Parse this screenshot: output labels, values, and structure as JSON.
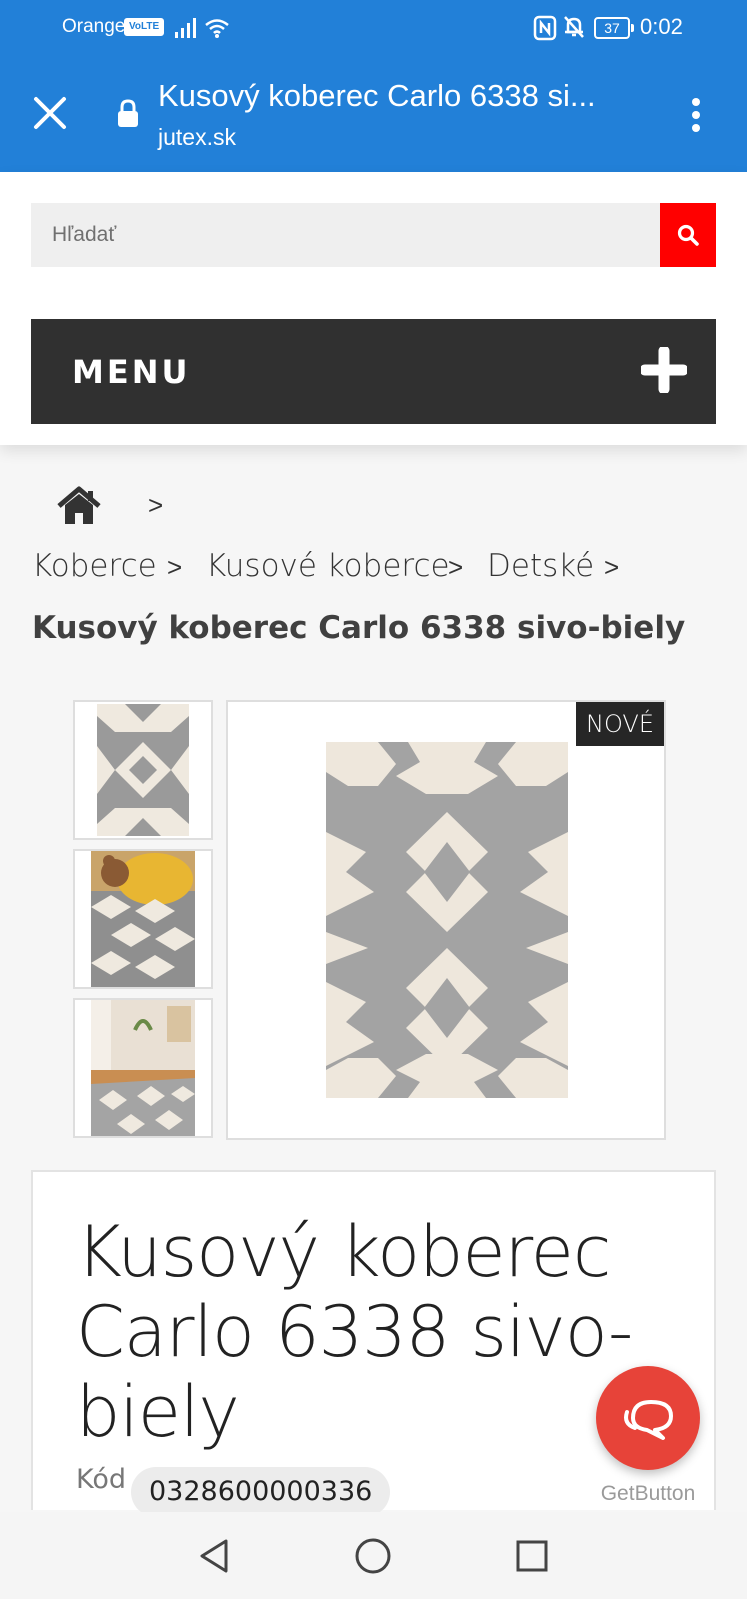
{
  "status_bar": {
    "carrier": "Orange",
    "volte": "VoLTE",
    "battery": "37",
    "time": "0:02"
  },
  "browser": {
    "page_title": "Kusový koberec Carlo 6338 si...",
    "domain": "jutex.sk"
  },
  "search": {
    "placeholder": "Hľadať"
  },
  "menu": {
    "label": "MENU"
  },
  "breadcrumbs": {
    "separator": ">",
    "items": [
      "Koberce",
      "Kusové koberce",
      "Detské"
    ]
  },
  "product": {
    "heading": "Kusový koberec Carlo 6338 sivo-biely",
    "title_lines": [
      "Kusový koberec",
      "Carlo 6338 sivo-",
      "biely"
    ],
    "badge": "NOVÉ",
    "code_label": "Kód",
    "code_value": "0328600000336"
  },
  "chat": {
    "caption": "GetButton"
  },
  "colors": {
    "browser_bar": "#2280d8",
    "search_button": "#ff0000",
    "menu_bar": "#303030",
    "chat_button": "#e74339"
  },
  "icons": [
    "close-icon",
    "lock-icon",
    "kebab-menu-icon",
    "search-icon",
    "plus-icon",
    "home-icon",
    "chat-icon",
    "nav-back-icon",
    "nav-home-icon",
    "nav-recents-icon"
  ]
}
